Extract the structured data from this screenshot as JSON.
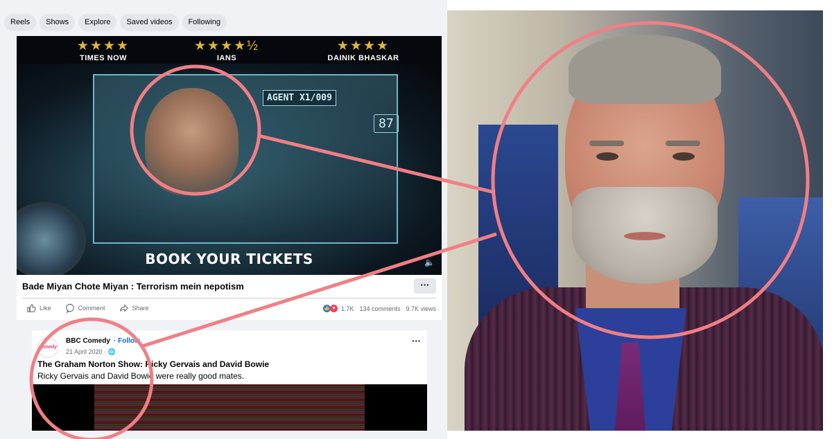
{
  "tabs": [
    "Reels",
    "Shows",
    "Explore",
    "Saved videos",
    "Following"
  ],
  "post1": {
    "ratings": [
      {
        "outlet": "TIMES NOW",
        "stars": "★★★★"
      },
      {
        "outlet": "IANS",
        "stars": "★★★★½"
      },
      {
        "outlet": "DAINIK BHASKAR",
        "stars": "★★★★"
      }
    ],
    "hud_agent": "AGENT X1/009",
    "hud_number": "87",
    "banner": "BOOK YOUR TICKETS",
    "title": "Bade Miyan Chote Miyan : Terrorism mein nepotism",
    "more": "···",
    "actions": {
      "like": "Like",
      "comment": "Comment",
      "share": "Share"
    },
    "reactions_count": "1.7K",
    "comments": "134 comments",
    "views": "9.7K views"
  },
  "post2": {
    "page_name": "BBC Comedy",
    "follow": "Follow",
    "date": "21 April 2020 · ",
    "more": "···",
    "title": "The Graham Norton Show: Ricky Gervais and David Bowie",
    "description": "Ricky Gervais and David Bowie were really good mates."
  },
  "colors": {
    "annotation": "#f07f86",
    "facebook_blue": "#0866ff",
    "chip_bg": "#e4e6eb"
  }
}
